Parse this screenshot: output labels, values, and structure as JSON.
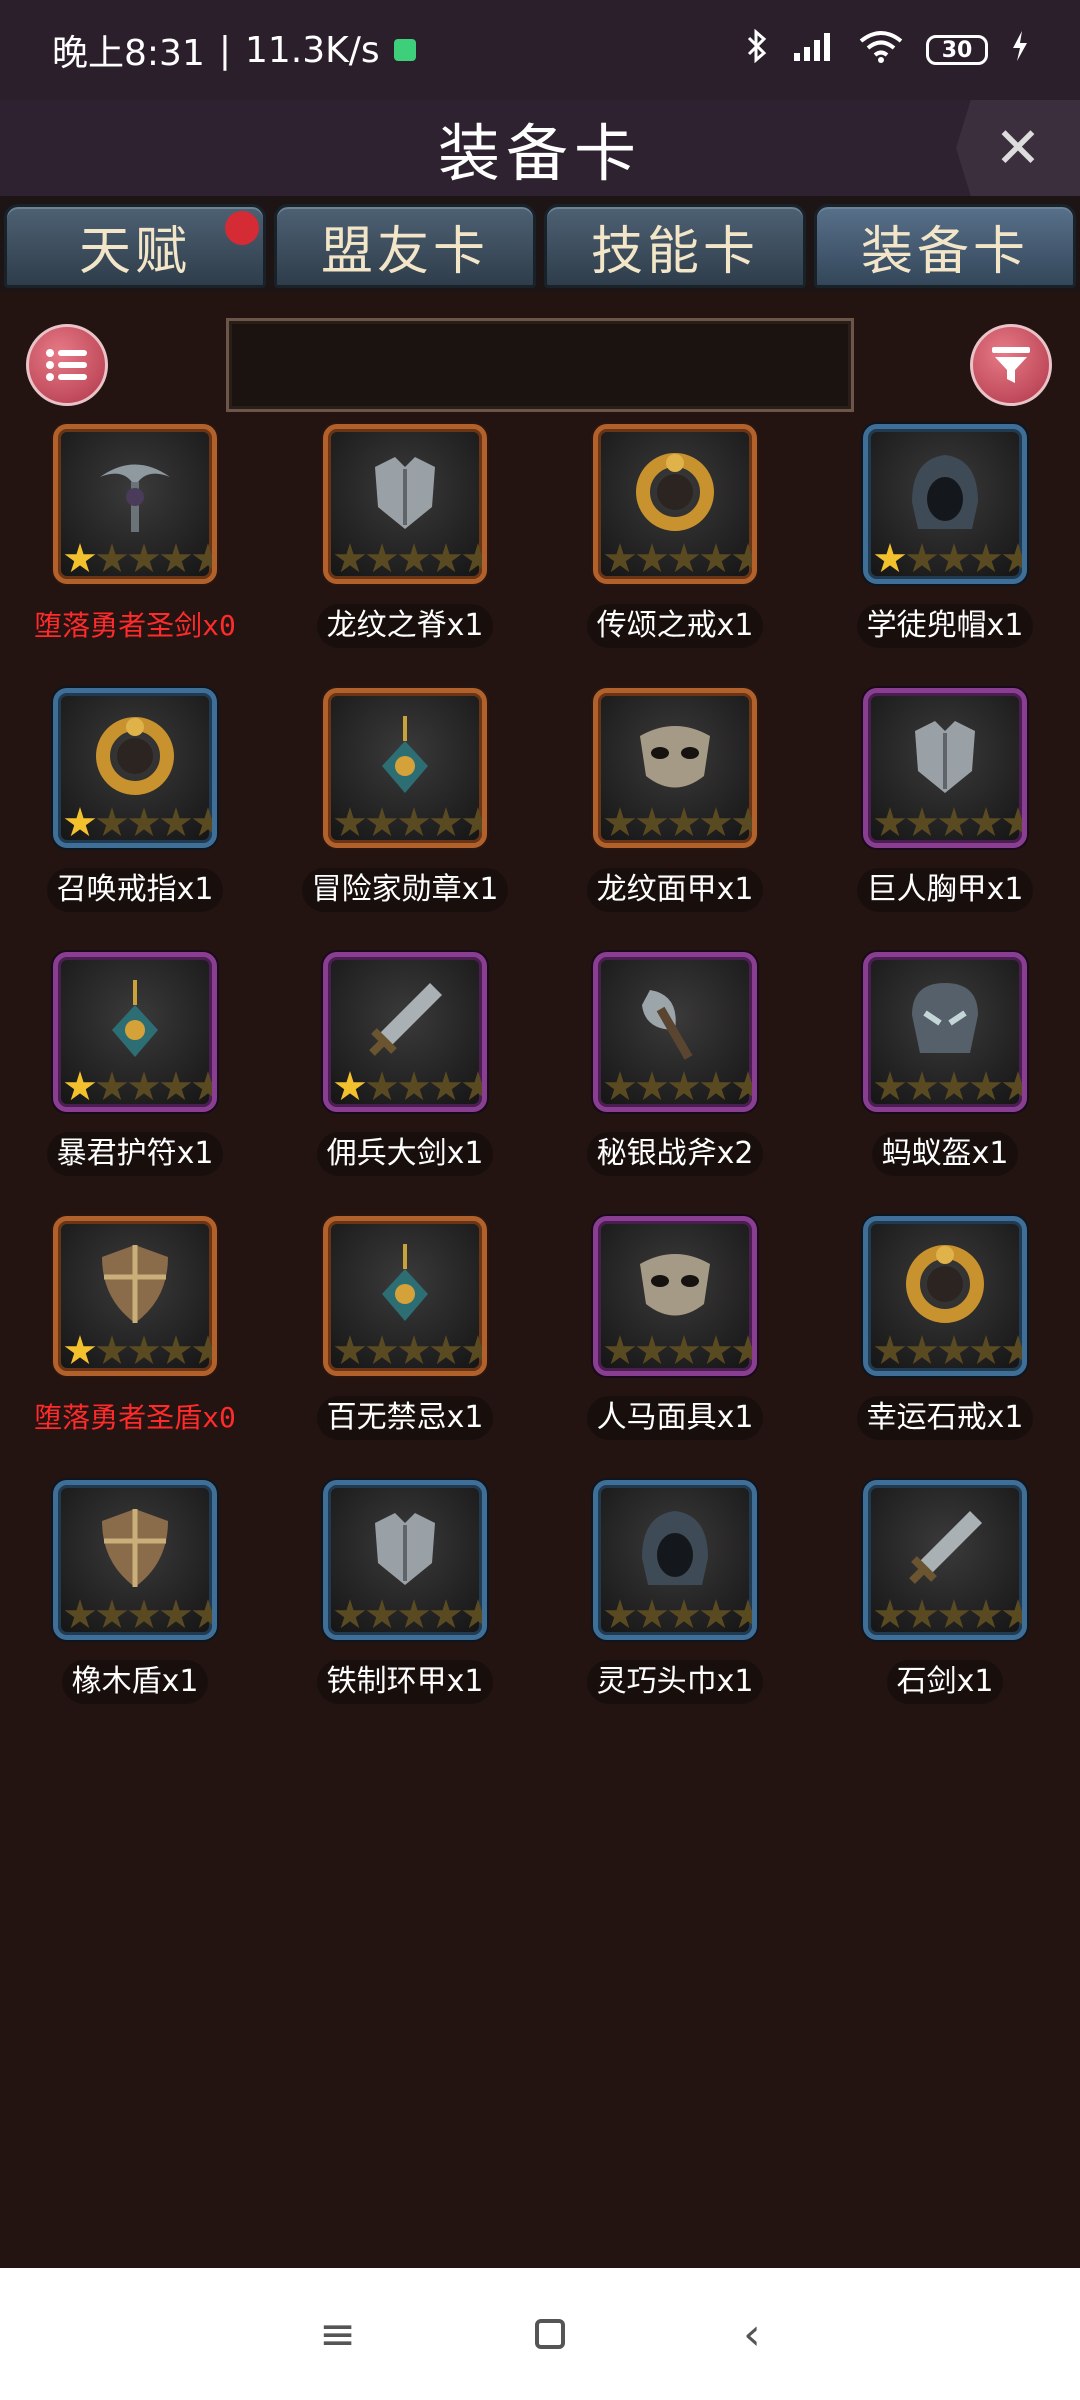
{
  "status_bar": {
    "time": "晚上8:31",
    "separator": "|",
    "speed": "11.3K/s",
    "battery": "30"
  },
  "title": "装备卡",
  "close_symbol": "✕",
  "tabs": [
    {
      "label": "天赋",
      "badge": true
    },
    {
      "label": "盟友卡",
      "badge": false
    },
    {
      "label": "技能卡",
      "badge": false
    },
    {
      "label": "装备卡",
      "badge": false,
      "active": true
    }
  ],
  "search": {
    "value": ""
  },
  "items": [
    {
      "name": "堕落勇者圣剑x0",
      "rarity": "orange",
      "stars": 1,
      "red": true,
      "icon": "scythe-icon"
    },
    {
      "name": "龙纹之脊x1",
      "rarity": "orange",
      "stars": 0,
      "red": false,
      "icon": "armor-icon"
    },
    {
      "name": "传颂之戒x1",
      "rarity": "orange",
      "stars": 0,
      "red": false,
      "icon": "ring-icon"
    },
    {
      "name": "学徒兜帽x1",
      "rarity": "blue",
      "stars": 1,
      "red": false,
      "icon": "hood-icon"
    },
    {
      "name": "召唤戒指x1",
      "rarity": "blue",
      "stars": 1,
      "red": false,
      "icon": "ring-icon"
    },
    {
      "name": "冒险家勋章x1",
      "rarity": "orange",
      "stars": 0,
      "red": false,
      "icon": "amulet-icon"
    },
    {
      "name": "龙纹面甲x1",
      "rarity": "orange",
      "stars": 0,
      "red": false,
      "icon": "mask-icon"
    },
    {
      "name": "巨人胸甲x1",
      "rarity": "purple",
      "stars": 0,
      "red": false,
      "icon": "armor-icon"
    },
    {
      "name": "暴君护符x1",
      "rarity": "purple",
      "stars": 1,
      "red": false,
      "icon": "amulet-icon"
    },
    {
      "name": "佣兵大剑x1",
      "rarity": "purple",
      "stars": 1,
      "red": false,
      "icon": "sword-icon"
    },
    {
      "name": "秘银战斧x2",
      "rarity": "purple",
      "stars": 0,
      "red": false,
      "icon": "axe-icon"
    },
    {
      "name": "蚂蚁盔x1",
      "rarity": "purple",
      "stars": 0,
      "red": false,
      "icon": "helmet-icon"
    },
    {
      "name": "堕落勇者圣盾x0",
      "rarity": "orange",
      "stars": 1,
      "red": true,
      "icon": "shield-icon"
    },
    {
      "name": "百无禁忌x1",
      "rarity": "orange",
      "stars": 0,
      "red": false,
      "icon": "amulet-icon"
    },
    {
      "name": "人马面具x1",
      "rarity": "purple",
      "stars": 0,
      "red": false,
      "icon": "mask-icon"
    },
    {
      "name": "幸运石戒x1",
      "rarity": "blue",
      "stars": 0,
      "red": false,
      "icon": "ring-icon"
    },
    {
      "name": "橡木盾x1",
      "rarity": "blue",
      "stars": 0,
      "red": false,
      "icon": "shield-icon"
    },
    {
      "name": "铁制环甲x1",
      "rarity": "blue",
      "stars": 0,
      "red": false,
      "icon": "armor-icon"
    },
    {
      "name": "灵巧头巾x1",
      "rarity": "blue",
      "stars": 0,
      "red": false,
      "icon": "hood-icon"
    },
    {
      "name": "石剑x1",
      "rarity": "blue",
      "stars": 0,
      "red": false,
      "icon": "sword-icon"
    }
  ],
  "nav": {
    "menu": "≡",
    "back": "‹"
  }
}
